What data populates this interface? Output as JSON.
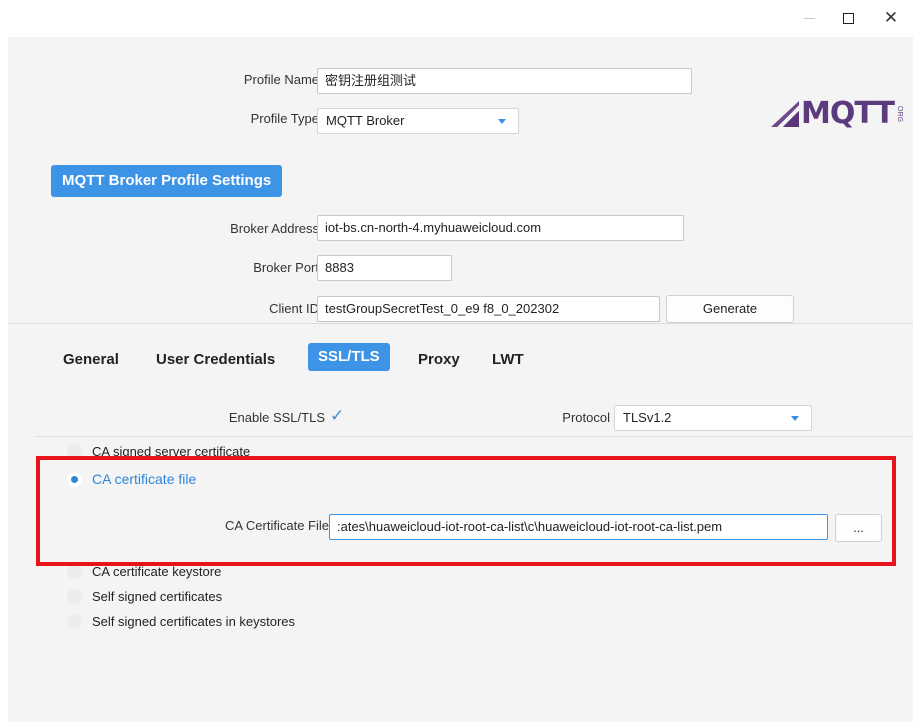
{
  "window": {
    "minimize_icon": "minimize-icon",
    "maximize_icon": "maximize-icon",
    "close_glyph": "✕"
  },
  "profile": {
    "name_label": "Profile Name",
    "name_value": "密钥注册组测试",
    "type_label": "Profile Type",
    "type_value": "MQTT Broker",
    "logo_text": "MQTT",
    "logo_org": "ORG"
  },
  "broker_section": {
    "title": "MQTT Broker Profile Settings",
    "address_label": "Broker Address",
    "address_value": "iot-bs.cn-north-4.myhuaweicloud.com",
    "port_label": "Broker Port",
    "port_value": "8883",
    "client_id_label": "Client ID",
    "client_id_value": "testGroupSecretTest_0_e9             f8_0_202302",
    "generate_label": "Generate"
  },
  "tabs": [
    {
      "label": "General",
      "active": false
    },
    {
      "label": "User Credentials",
      "active": false
    },
    {
      "label": "SSL/TLS",
      "active": true
    },
    {
      "label": "Proxy",
      "active": false
    },
    {
      "label": "LWT",
      "active": false
    }
  ],
  "ssl": {
    "enable_label": "Enable SSL/TLS",
    "enable_checked": true,
    "checkmark": "✓",
    "protocol_label": "Protocol",
    "protocol_value": "TLSv1.2",
    "options": [
      {
        "label": "CA signed server certificate",
        "selected": false
      },
      {
        "label": "CA certificate file",
        "selected": true
      },
      {
        "label": "CA certificate keystore",
        "selected": false
      },
      {
        "label": "Self signed certificates",
        "selected": false
      },
      {
        "label": "Self signed certificates in keystores",
        "selected": false
      }
    ],
    "ca_file_label": "CA Certificate File",
    "ca_file_value": ":ates\\huaweicloud-iot-root-ca-list\\c\\huaweicloud-iot-root-ca-list.pem",
    "browse_label": "..."
  },
  "colors": {
    "accent": "#3d94e6",
    "highlight": "#e8141b",
    "logo": "#5c3a7e"
  }
}
